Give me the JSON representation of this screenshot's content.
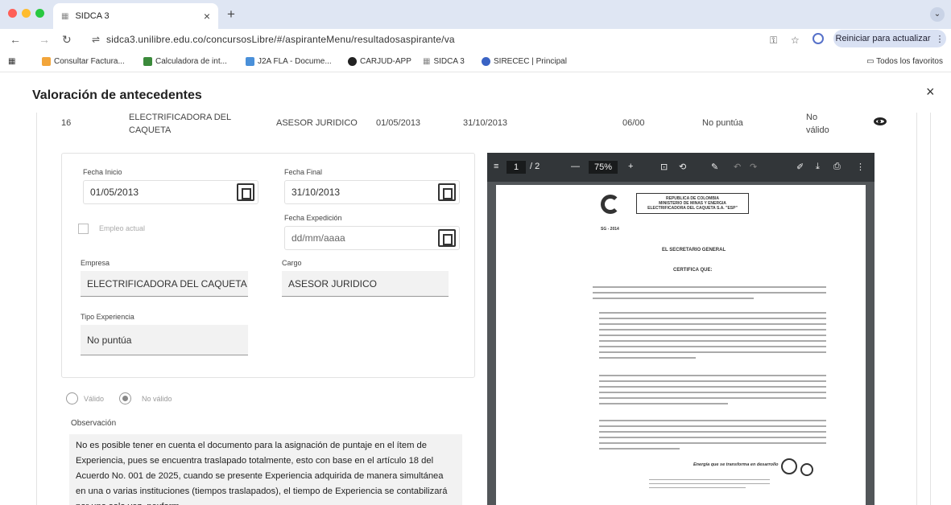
{
  "browser": {
    "tab_title": "SIDCA 3",
    "tab_favicon": "cuadro",
    "tab_close": "×",
    "new_tab": "+",
    "tab_menu": "⌄",
    "url": "sidca3.unilibre.edu.co/concursosLibre/#/aspiranteMenu/resultadosaspirante/va",
    "reload_button": "Reiniciar para actualizar",
    "bookmarks": [
      "Consultar Factura...",
      "Calculadora de int...",
      "J2A FLA - Docume...",
      "CARJUD-APP",
      "SIDCA 3",
      "SIRECEC | Principal"
    ],
    "all_bookmarks": "Todos los favoritos",
    "icons": [
      "back-icon",
      "forward-icon",
      "reload-icon",
      "site-info-icon",
      "key-icon",
      "star-icon",
      "extension-icon",
      "apps-icon",
      "folder-icon"
    ],
    "colors": {
      "close_dot": "#ff5f57",
      "min_dot": "#febc2e",
      "max_dot": "#28c840",
      "accent": "#5671c9"
    }
  },
  "dialog": {
    "title": "Valoración de antecedentes",
    "close": "×",
    "row": {
      "index": "16",
      "company_line1": "ELECTRIFICADORA DEL",
      "company_line2": "CAQUETA",
      "position": "ASESOR JURIDICO",
      "start": "01/05/2013",
      "end": "31/10/2013",
      "duration": "06/00",
      "score": "No puntúa",
      "status_line1": "No",
      "status_line2": "válido"
    },
    "form": {
      "fecha_inicio_label": "Fecha Inicio",
      "fecha_inicio": "01/05/2013",
      "fecha_final_label": "Fecha Final",
      "fecha_final": "31/10/2013",
      "fecha_expedicion_label": "Fecha Expedición",
      "fecha_expedicion": "dd/mm/aaaa",
      "empleo_actual_label": "Empleo actual",
      "empresa_label": "Empresa",
      "empresa": "ELECTRIFICADORA DEL CAQUETA",
      "cargo_label": "Cargo",
      "cargo": "ASESOR JURIDICO",
      "tipo_experiencia_label": "Tipo Experiencia",
      "tipo_experiencia": "No puntúa"
    },
    "validation": {
      "valid_label": "Válido",
      "invalid_label": "No válido",
      "selected": "No válido"
    },
    "observacion_label": "Observación",
    "observacion": "No es posible tener en cuenta el documento para la asignación de puntaje en el ítem de Experiencia, pues se encuentra traslapado totalmente, esto con base en el artículo 18 del Acuerdo No. 001 de 2025, cuando se presente Experiencia adquirida de manera simultánea en una o varias instituciones (tiempos traslapados), el tiempo de Experiencia se contabilizará por una sola vez. nexform."
  },
  "pdf": {
    "page": "1",
    "page_total": "/ 2",
    "zoom": "75%",
    "doc_header": "REPUBLICA DE COLOMBIA\nMINISTERIO DE MINAS Y ENERGIA\nELECTRIFICADORA DEL CAQUETA S.A. \"ESP\"",
    "doc_code": "SG - 2014",
    "secretario": "EL SECRETARIO GENERAL",
    "certifica": "CERTIFICA QUE:",
    "slogan": "Energía que se transforma en desarrollo"
  }
}
